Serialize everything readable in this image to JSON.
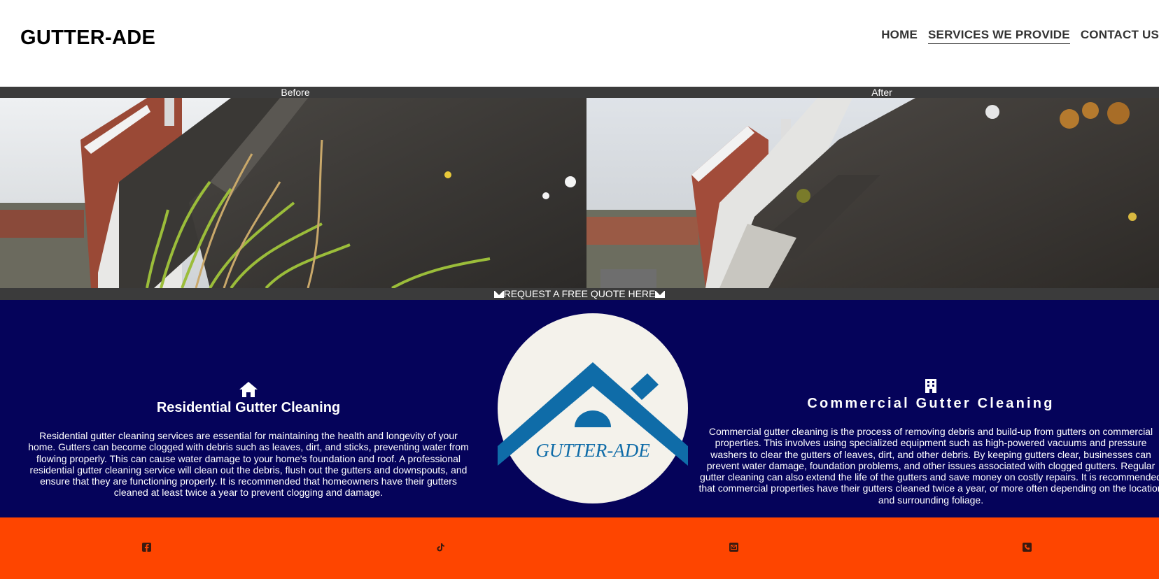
{
  "header": {
    "brand": "GUTTER-ADE",
    "nav": [
      "HOME",
      "SERVICES WE PROVIDE",
      "CONTACT US"
    ],
    "active_nav": "SERVICES WE PROVIDE"
  },
  "gallery": {
    "before_label": "Before",
    "after_label": "After",
    "quote_cta": "REQUEST A FREE QUOTE HERE",
    "quote_icon": "envelope-icon"
  },
  "services": {
    "residential": {
      "icon": "house-icon",
      "title": "Residential Gutter Cleaning",
      "body": "Residential gutter cleaning services are essential for maintaining the health and longevity of your home. Gutters can become clogged with debris such as leaves, dirt, and sticks, preventing water from flowing properly. This can cause water damage to your home's foundation and roof. A professional residential gutter cleaning service will clean out the debris, flush out the gutters and downspouts, and ensure that they are functioning properly. It is recommended that homeowners have their gutters cleaned at least twice a year to prevent clogging and damage."
    },
    "logo_text": "GUTTER-ADE",
    "commercial": {
      "icon": "building-icon",
      "title": "Commercial Gutter Cleaning",
      "body": "Commercial gutter cleaning is the process of removing debris and build-up from gutters on commercial properties. This involves using specialized equipment such as high-powered vacuums and pressure washers to clear the gutters of leaves, dirt, and other debris. By keeping gutters clear, businesses can prevent water damage, foundation problems, and other issues associated with clogged gutters. Regular gutter cleaning can also extend the life of the gutters and save money on costly repairs. It is recommended that commercial properties have their gutters cleaned twice a year, or more often depending on the location and surrounding foliage."
    }
  },
  "footer": {
    "icons": [
      "facebook-icon",
      "tiktok-icon",
      "email-icon",
      "phone-icon"
    ]
  },
  "colors": {
    "services_bg": "#05035a",
    "footer_bg": "#fe4500",
    "band_bg": "#3b3b3b",
    "logo_blue": "#0f6ca8"
  }
}
